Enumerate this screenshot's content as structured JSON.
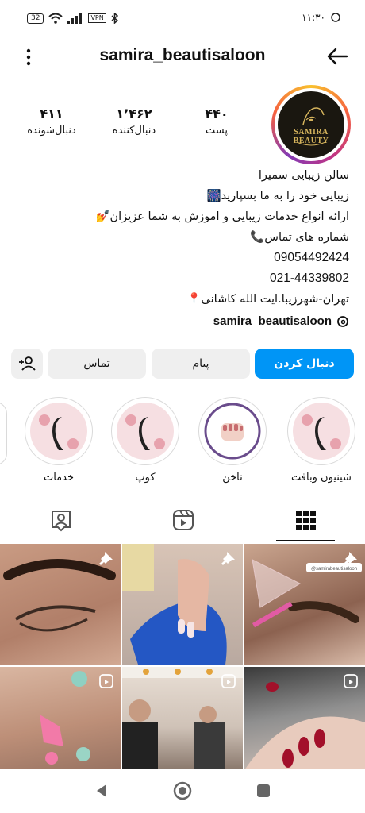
{
  "status_bar": {
    "battery": "32",
    "vpn": "VPN",
    "time": "۱۱:۳۰"
  },
  "header": {
    "username": "samira_beautisaloon"
  },
  "profile": {
    "avatar_text": "SAMIRA BEAUTY",
    "stats": [
      {
        "value": "۴۴۰",
        "label": "پست"
      },
      {
        "value": "۱٬۴۶۲",
        "label": "دنبال‌کننده"
      },
      {
        "value": "۴۱۱",
        "label": "دنبال‌شونده"
      }
    ],
    "bio_lines": [
      "سالن زیبایی سمیرا",
      "زیبایی خود را به ما بسپارید🎆",
      "ارائه انواع خدمات زیبایی و اموزش به شما عزیزان💅",
      "شماره های تماس📞",
      "09054492424",
      "021-44339802",
      "تهران-شهرزیبا.ایت الله کاشانی📍"
    ],
    "threads_handle": "samira_beautisaloon"
  },
  "actions": {
    "follow": "دنبال کردن",
    "message": "پیام",
    "contact": "تماس"
  },
  "highlights": [
    {
      "label": "شینیون وبافت"
    },
    {
      "label": "ناخن"
    },
    {
      "label": "کوپ"
    },
    {
      "label": "خدمات"
    }
  ],
  "colors": {
    "accent": "#0095f6",
    "button_bg": "#efefef"
  },
  "icons": [
    "menu-dots-icon",
    "back-arrow-icon",
    "threads-icon",
    "add-person-icon",
    "grid-icon",
    "reels-icon",
    "tagged-icon",
    "pin-icon",
    "reel-icon"
  ],
  "grid_posts": [
    {
      "badge": "pin"
    },
    {
      "badge": "pin"
    },
    {
      "badge": "pin",
      "tag": "@samirabeautisaloon"
    },
    {
      "badge": "reel"
    },
    {
      "badge": "reel"
    },
    {
      "badge": "reel"
    }
  ]
}
